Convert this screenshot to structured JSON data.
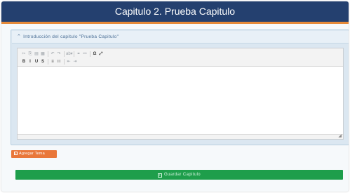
{
  "header": {
    "title": "Capitulo 2. Prueba Capitulo"
  },
  "panel": {
    "title": "Introducción del capitulo \"Prueba Capitulo\"",
    "chevron_icon": "chevron-up-icon"
  },
  "toolbar": {
    "row1": [
      {
        "name": "cut-icon",
        "glyph": "✂"
      },
      {
        "name": "copy-icon",
        "glyph": "⎘"
      },
      {
        "name": "paste-icon",
        "glyph": "▤"
      },
      {
        "name": "paste-text-icon",
        "glyph": "▦"
      },
      {
        "sep": true
      },
      {
        "name": "undo-icon",
        "glyph": "↶"
      },
      {
        "name": "redo-icon",
        "glyph": "↷"
      },
      {
        "sep": true
      },
      {
        "name": "spellcheck-icon",
        "glyph": "ab▾"
      },
      {
        "sep": true
      },
      {
        "name": "link-icon",
        "glyph": "⚭"
      },
      {
        "name": "unlink-icon",
        "glyph": "⚯"
      },
      {
        "sep": true
      },
      {
        "name": "special-char-icon",
        "glyph": "Ω",
        "dark": true
      },
      {
        "name": "maximize-icon",
        "glyph": "⤢",
        "dark": true
      }
    ],
    "row2": [
      {
        "name": "bold-icon",
        "glyph": "B",
        "dark": true
      },
      {
        "name": "italic-icon",
        "glyph": "I",
        "dark": true
      },
      {
        "name": "underline-icon",
        "glyph": "U",
        "dark": true
      },
      {
        "name": "strikethrough-icon",
        "glyph": "S",
        "dark": true
      },
      {
        "sep": true
      },
      {
        "name": "numbered-list-icon",
        "glyph": "≡",
        "dark": true
      },
      {
        "name": "bulleted-list-icon",
        "glyph": "∷",
        "dark": true
      },
      {
        "sep": true
      },
      {
        "name": "outdent-icon",
        "glyph": "⇤"
      },
      {
        "name": "indent-icon",
        "glyph": "⇥"
      }
    ]
  },
  "buttons": {
    "add_topic": "Agregar Tema",
    "save_chapter": "Guardar Capitulo"
  },
  "colors": {
    "header_bg": "#24406f",
    "accent_orange": "#e9773a",
    "save_green": "#1e9e4b"
  }
}
